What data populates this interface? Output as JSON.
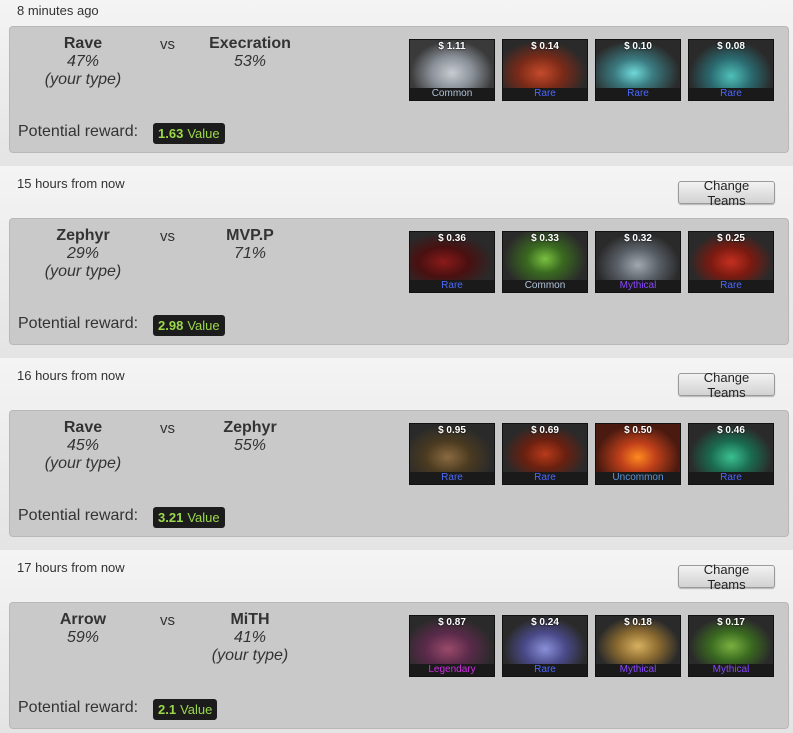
{
  "matches": [
    {
      "time": "8 minutes ago",
      "show_change_button": false,
      "team_left": {
        "name": "Rave",
        "pct": "47%",
        "note": "(your type)"
      },
      "vs": "vs",
      "team_right": {
        "name": "Execration",
        "pct": "53%",
        "note": ""
      },
      "reward_label": "Potential reward:",
      "reward_value": "1.63",
      "reward_unit": "Value",
      "items": [
        {
          "price": "$ 1.11",
          "rarity": "Common",
          "rarity_class": "common",
          "art": "grey-bust"
        },
        {
          "price": "$ 0.14",
          "rarity": "Rare",
          "rarity_class": "rare",
          "art": "red-armor"
        },
        {
          "price": "$ 0.10",
          "rarity": "Rare",
          "rarity_class": "rare",
          "art": "teal-hammer"
        },
        {
          "price": "$ 0.08",
          "rarity": "Rare",
          "rarity_class": "rare",
          "art": "teal-wing"
        }
      ]
    },
    {
      "time": "15 hours from now",
      "show_change_button": true,
      "change_label": "Change Teams",
      "team_left": {
        "name": "Zephyr",
        "pct": "29%",
        "note": "(your type)"
      },
      "vs": "vs",
      "team_right": {
        "name": "MVP.P",
        "pct": "71%",
        "note": ""
      },
      "reward_label": "Potential reward:",
      "reward_value": "2.98",
      "reward_unit": "Value",
      "items": [
        {
          "price": "$ 0.36",
          "rarity": "Rare",
          "rarity_class": "rare",
          "art": "red-scythe"
        },
        {
          "price": "$ 0.33",
          "rarity": "Common",
          "rarity_class": "common",
          "art": "green-mask"
        },
        {
          "price": "$ 0.32",
          "rarity": "Mythical",
          "rarity_class": "mythical",
          "art": "grey-wolf"
        },
        {
          "price": "$ 0.25",
          "rarity": "Rare",
          "rarity_class": "rare",
          "art": "red-cape"
        }
      ]
    },
    {
      "time": "16 hours from now",
      "show_change_button": true,
      "change_label": "Change Teams",
      "team_left": {
        "name": "Rave",
        "pct": "45%",
        "note": "(your type)"
      },
      "vs": "vs",
      "team_right": {
        "name": "Zephyr",
        "pct": "55%",
        "note": ""
      },
      "reward_label": "Potential reward:",
      "reward_value": "3.21",
      "reward_unit": "Value",
      "items": [
        {
          "price": "$ 0.95",
          "rarity": "Rare",
          "rarity_class": "rare",
          "art": "brown-boot"
        },
        {
          "price": "$ 0.69",
          "rarity": "Rare",
          "rarity_class": "rare",
          "art": "red-claw"
        },
        {
          "price": "$ 0.50",
          "rarity": "Uncommon",
          "rarity_class": "uncommon",
          "art": "fire-demon"
        },
        {
          "price": "$ 0.46",
          "rarity": "Rare",
          "rarity_class": "rare",
          "art": "green-figure"
        }
      ]
    },
    {
      "time": "17 hours from now",
      "show_change_button": true,
      "change_label": "Change Teams",
      "team_left": {
        "name": "Arrow",
        "pct": "59%",
        "note": ""
      },
      "vs": "vs",
      "team_right": {
        "name": "MiTH",
        "pct": "41%",
        "note": "(your type)"
      },
      "reward_label": "Potential reward:",
      "reward_value": "2.1",
      "reward_unit": "Value",
      "items": [
        {
          "price": "$ 0.87",
          "rarity": "Legendary",
          "rarity_class": "legendary",
          "art": "purple-beast"
        },
        {
          "price": "$ 0.24",
          "rarity": "Rare",
          "rarity_class": "rare",
          "art": "blue-creature"
        },
        {
          "price": "$ 0.18",
          "rarity": "Mythical",
          "rarity_class": "mythical",
          "art": "gold-horn"
        },
        {
          "price": "$ 0.17",
          "rarity": "Mythical",
          "rarity_class": "mythical",
          "art": "green-goblin"
        }
      ]
    }
  ],
  "colors": {
    "card_bg": "#c9c9c9",
    "reward_green": "#9bd84a",
    "rare": "#4b69ff",
    "common": "#b0c3d9",
    "uncommon": "#5e98d9",
    "mythical": "#8847ff",
    "legendary": "#d32ce6"
  }
}
